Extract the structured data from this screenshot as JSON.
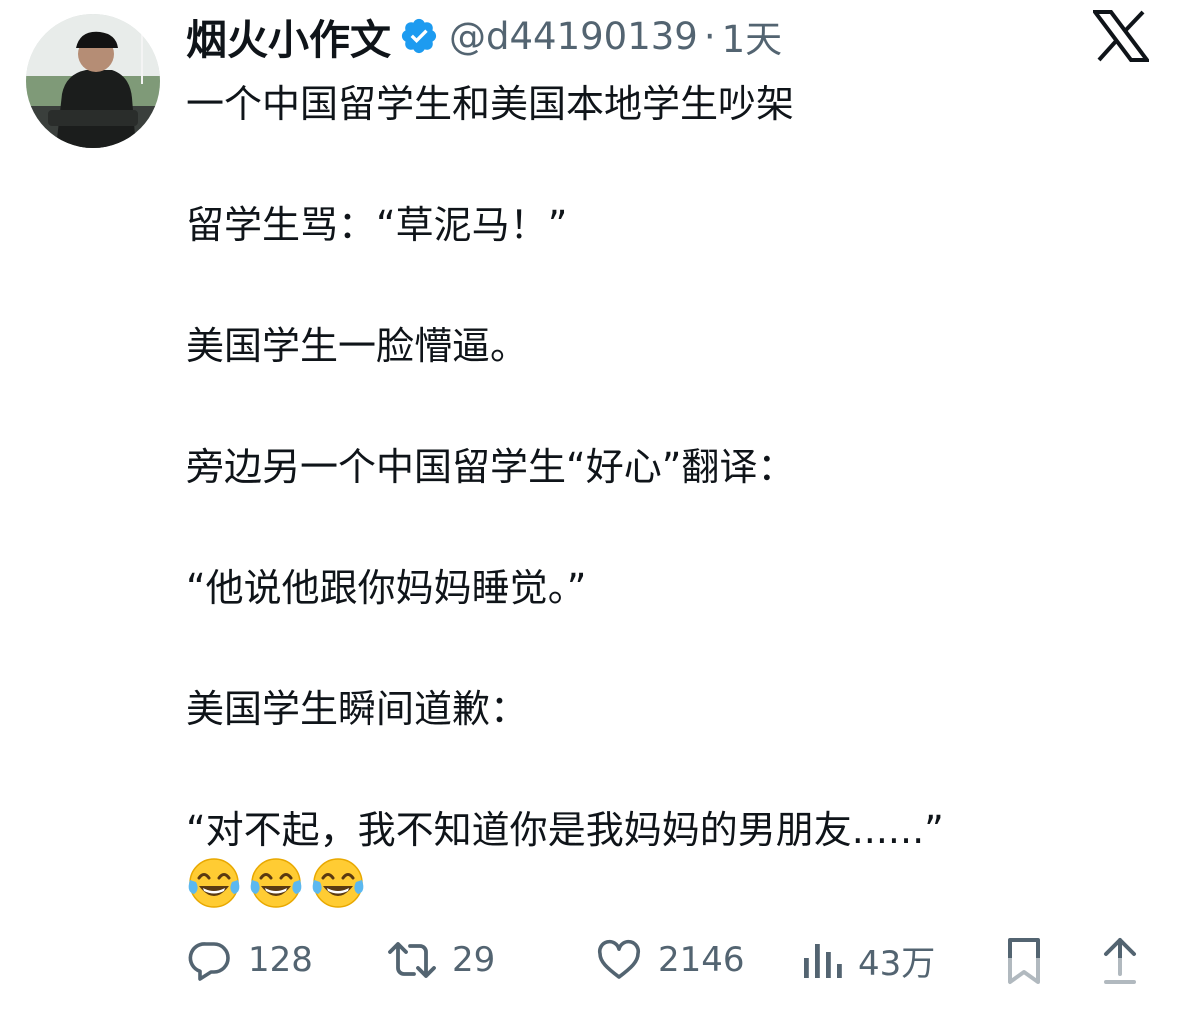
{
  "author": {
    "display_name": "烟火小作文",
    "handle": "@d44190139",
    "separator": "·",
    "time": "1天",
    "verified_icon": "verified-badge-icon",
    "avatar": "profile-photo"
  },
  "platform_logo": "x-logo-icon",
  "tweet": {
    "lines": [
      "一个中国留学生和美国本地学生吵架",
      "",
      "留学生骂：“草泥马！”",
      "",
      "美国学生一脸懵逼。",
      "",
      "旁边另一个中国留学生“好心”翻译：",
      "",
      "“他说他跟你妈妈睡觉。”",
      "",
      "美国学生瞬间道歉：",
      "",
      "“对不起，我不知道你是我妈妈的男朋友......”"
    ],
    "emojis": [
      "tears-of-joy-emoji",
      "tears-of-joy-emoji",
      "tears-of-joy-emoji"
    ]
  },
  "actions": {
    "reply": {
      "icon": "reply-icon",
      "count": "128"
    },
    "retweet": {
      "icon": "retweet-icon",
      "count": "29"
    },
    "like": {
      "icon": "heart-icon",
      "count": "2146"
    },
    "views": {
      "icon": "views-chart-icon",
      "count": "43万"
    },
    "bookmark": {
      "icon": "bookmark-icon"
    },
    "share": {
      "icon": "share-icon"
    }
  },
  "colors": {
    "text": "#0f1419",
    "secondary": "#536471",
    "verified": "#1d9bf0"
  }
}
